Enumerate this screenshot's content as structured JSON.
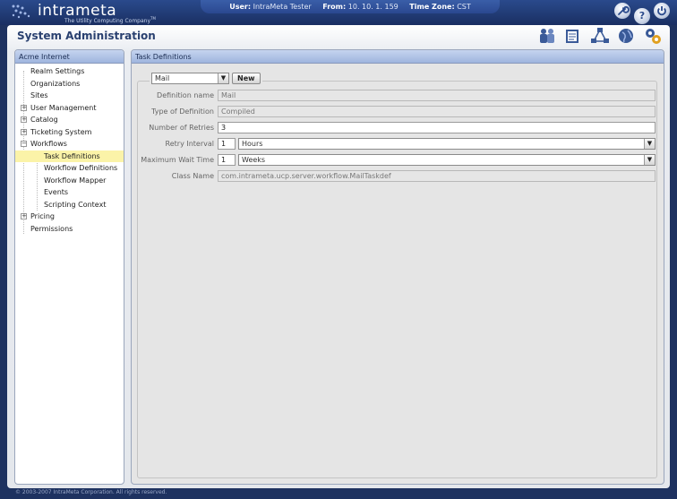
{
  "app": {
    "logo_name": "intrameta",
    "logo_tagline": "The Utility Computing Company",
    "logo_tm": "TM"
  },
  "session": {
    "user_label": "User:",
    "user_value": "IntraMeta Tester",
    "from_label": "From:",
    "from_value": "10. 10. 1. 159",
    "tz_label": "Time Zone:",
    "tz_value": "CST"
  },
  "top_icons": [
    "wrench-icon",
    "help-icon",
    "power-icon"
  ],
  "page_title": "System Administration",
  "app_tools": [
    "users-icon",
    "reports-icon",
    "network-icon",
    "globe-icon",
    "settings-gears-icon"
  ],
  "sidebar": {
    "header": "Acme Internet",
    "items": [
      {
        "label": "Realm Settings",
        "level": 0,
        "expander": ""
      },
      {
        "label": "Organizations",
        "level": 0,
        "expander": ""
      },
      {
        "label": "Sites",
        "level": 0,
        "expander": ""
      },
      {
        "label": "User Management",
        "level": 0,
        "expander": "+"
      },
      {
        "label": "Catalog",
        "level": 0,
        "expander": "+"
      },
      {
        "label": "Ticketing System",
        "level": 0,
        "expander": "+"
      },
      {
        "label": "Workflows",
        "level": 0,
        "expander": "−"
      },
      {
        "label": "Task Definitions",
        "level": 1,
        "expander": "",
        "selected": true
      },
      {
        "label": "Workflow Definitions",
        "level": 1,
        "expander": ""
      },
      {
        "label": "Workflow Mapper",
        "level": 1,
        "expander": ""
      },
      {
        "label": "Events",
        "level": 1,
        "expander": ""
      },
      {
        "label": "Scripting Context",
        "level": 1,
        "expander": ""
      },
      {
        "label": "Pricing",
        "level": 0,
        "expander": "+"
      },
      {
        "label": "Permissions",
        "level": 0,
        "expander": ""
      }
    ]
  },
  "content": {
    "header": "Task Definitions",
    "task_select_value": "Mail",
    "new_button": "New",
    "fields": {
      "definition_name_label": "Definition name",
      "definition_name_value": "Mail",
      "type_label": "Type of Definition",
      "type_value": "Compiled",
      "retries_label": "Number of Retries",
      "retries_value": "3",
      "retry_interval_label": "Retry Interval",
      "retry_interval_value": "1",
      "retry_interval_unit": "Hours",
      "max_wait_label": "Maximum Wait Time",
      "max_wait_value": "1",
      "max_wait_unit": "Weeks",
      "class_name_label": "Class Name",
      "class_name_value": "com.intrameta.ucp.server.workflow.MailTaskdef"
    }
  },
  "footer": "© 2003-2007 IntraMeta Corporation.  All rights reserved."
}
